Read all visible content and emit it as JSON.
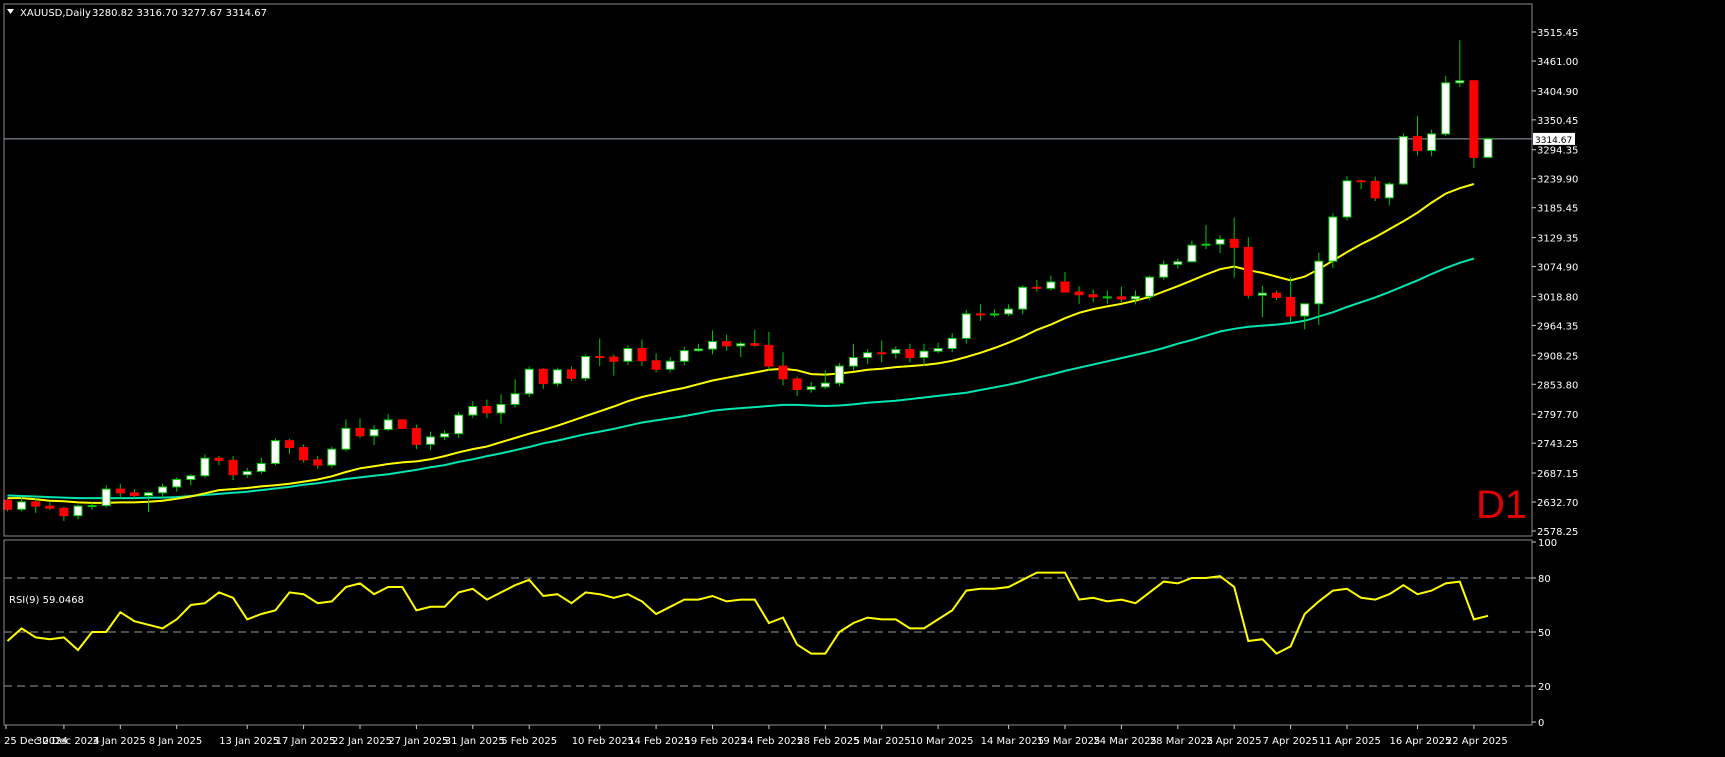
{
  "header": {
    "symbol_line": "XAUUSD,Daily",
    "ohlc": "3280.82 3316.70 3277.67 3314.67"
  },
  "timeframe_badge": "D1",
  "rsi_header": "RSI(9) 59.0468",
  "current_price_label": "3314.67",
  "colors": {
    "background": "#000000",
    "bull_candle": "#ffffff",
    "bear_candle": "#ff0000",
    "wick": "#00c800",
    "ma_fast": "#ffff00",
    "ma_slow": "#00e5b0",
    "rsi_line": "#ffff00",
    "timeframe": "#e00000"
  },
  "chart_data": [
    {
      "type": "candlestick",
      "title": "XAUUSD,Daily",
      "ylim": [
        2578.25,
        3538.0
      ],
      "y_ticks": [
        "3515.45",
        "3461.00",
        "3404.90",
        "3350.45",
        "3294.35",
        "3239.90",
        "3185.45",
        "3129.35",
        "3074.90",
        "3018.80",
        "2964.35",
        "2908.25",
        "2853.80",
        "2797.70",
        "2743.25",
        "2687.15",
        "2632.70",
        "2578.25"
      ],
      "x_ticks": [
        "25 Dec 2024",
        "30 Dec 2024",
        "3 Jan 2025",
        "8 Jan 2025",
        "13 Jan 2025",
        "17 Jan 2025",
        "22 Jan 2025",
        "27 Jan 2025",
        "31 Jan 2025",
        "5 Feb 2025",
        "10 Feb 2025",
        "14 Feb 2025",
        "19 Feb 2025",
        "24 Feb 2025",
        "28 Feb 2025",
        "5 Mar 2025",
        "10 Mar 2025",
        "14 Mar 2025",
        "19 Mar 2025",
        "24 Mar 2025",
        "28 Mar 2025",
        "2 Apr 2025",
        "7 Apr 2025",
        "11 Apr 2025",
        "16 Apr 2025",
        "22 Apr 2025"
      ],
      "last_price": 3314.67,
      "candles": [
        [
          2636,
          2638,
          2615,
          2619
        ],
        [
          2619,
          2642,
          2615,
          2633
        ],
        [
          2633,
          2640,
          2612,
          2625
        ],
        [
          2625,
          2632,
          2618,
          2621
        ],
        [
          2621,
          2624,
          2597,
          2607
        ],
        [
          2607,
          2628,
          2600,
          2625
        ],
        [
          2625,
          2631,
          2618,
          2626
        ],
        [
          2626,
          2664,
          2622,
          2657
        ],
        [
          2657,
          2667,
          2640,
          2650
        ],
        [
          2650,
          2657,
          2638,
          2645
        ],
        [
          2645,
          2652,
          2614,
          2650
        ],
        [
          2650,
          2667,
          2640,
          2661
        ],
        [
          2661,
          2679,
          2652,
          2675
        ],
        [
          2675,
          2685,
          2664,
          2682
        ],
        [
          2682,
          2722,
          2678,
          2715
        ],
        [
          2715,
          2719,
          2702,
          2711
        ],
        [
          2711,
          2719,
          2674,
          2684
        ],
        [
          2684,
          2697,
          2678,
          2690
        ],
        [
          2690,
          2716,
          2685,
          2705
        ],
        [
          2705,
          2752,
          2702,
          2748
        ],
        [
          2748,
          2751,
          2723,
          2735
        ],
        [
          2735,
          2741,
          2707,
          2712
        ],
        [
          2712,
          2719,
          2696,
          2702
        ],
        [
          2702,
          2737,
          2697,
          2732
        ],
        [
          2732,
          2788,
          2728,
          2771
        ],
        [
          2771,
          2790,
          2753,
          2757
        ],
        [
          2757,
          2777,
          2740,
          2769
        ],
        [
          2769,
          2798,
          2766,
          2787
        ],
        [
          2787,
          2788,
          2770,
          2771
        ],
        [
          2771,
          2778,
          2732,
          2741
        ],
        [
          2741,
          2765,
          2730,
          2755
        ],
        [
          2755,
          2767,
          2749,
          2761
        ],
        [
          2761,
          2802,
          2753,
          2796
        ],
        [
          2796,
          2822,
          2791,
          2812
        ],
        [
          2812,
          2825,
          2790,
          2800
        ],
        [
          2800,
          2835,
          2780,
          2816
        ],
        [
          2816,
          2863,
          2810,
          2836
        ],
        [
          2836,
          2887,
          2830,
          2882
        ],
        [
          2882,
          2884,
          2845,
          2855
        ],
        [
          2855,
          2885,
          2850,
          2881
        ],
        [
          2881,
          2887,
          2860,
          2865
        ],
        [
          2865,
          2910,
          2860,
          2906
        ],
        [
          2906,
          2940,
          2888,
          2905
        ],
        [
          2905,
          2910,
          2870,
          2897
        ],
        [
          2897,
          2927,
          2890,
          2921
        ],
        [
          2921,
          2938,
          2888,
          2898
        ],
        [
          2898,
          2912,
          2876,
          2882
        ],
        [
          2882,
          2905,
          2877,
          2897
        ],
        [
          2897,
          2924,
          2890,
          2917
        ],
        [
          2917,
          2930,
          2915,
          2920
        ],
        [
          2920,
          2955,
          2910,
          2934
        ],
        [
          2934,
          2947,
          2917,
          2926
        ],
        [
          2926,
          2934,
          2905,
          2930
        ],
        [
          2930,
          2956,
          2924,
          2927
        ],
        [
          2927,
          2952,
          2880,
          2888
        ],
        [
          2888,
          2914,
          2852,
          2864
        ],
        [
          2864,
          2868,
          2832,
          2844
        ],
        [
          2844,
          2858,
          2838,
          2849
        ],
        [
          2849,
          2880,
          2845,
          2856
        ],
        [
          2856,
          2894,
          2850,
          2888
        ],
        [
          2888,
          2930,
          2880,
          2904
        ],
        [
          2904,
          2920,
          2892,
          2913
        ],
        [
          2913,
          2936,
          2895,
          2912
        ],
        [
          2912,
          2925,
          2902,
          2919
        ],
        [
          2919,
          2930,
          2895,
          2904
        ],
        [
          2904,
          2930,
          2888,
          2916
        ],
        [
          2916,
          2932,
          2912,
          2921
        ],
        [
          2921,
          2950,
          2914,
          2940
        ],
        [
          2940,
          2994,
          2930,
          2986
        ],
        [
          2986,
          3004,
          2973,
          2984
        ],
        [
          2984,
          2995,
          2980,
          2986
        ],
        [
          2986,
          3004,
          2982,
          2995
        ],
        [
          2995,
          3040,
          2985,
          3036
        ],
        [
          3036,
          3050,
          3028,
          3034
        ],
        [
          3034,
          3058,
          3030,
          3046
        ],
        [
          3046,
          3065,
          3028,
          3027
        ],
        [
          3027,
          3038,
          3005,
          3022
        ],
        [
          3022,
          3032,
          3008,
          3018
        ],
        [
          3018,
          3030,
          3005,
          3018
        ],
        [
          3018,
          3037,
          3008,
          3014
        ],
        [
          3014,
          3030,
          3004,
          3019
        ],
        [
          3019,
          3058,
          3012,
          3055
        ],
        [
          3055,
          3086,
          3050,
          3079
        ],
        [
          3079,
          3090,
          3071,
          3084
        ],
        [
          3084,
          3124,
          3083,
          3115
        ],
        [
          3115,
          3153,
          3108,
          3117
        ],
        [
          3117,
          3134,
          3100,
          3126
        ],
        [
          3126,
          3167,
          3054,
          3111
        ],
        [
          3111,
          3130,
          3015,
          3021
        ],
        [
          3021,
          3039,
          2980,
          3025
        ],
        [
          3025,
          3030,
          3012,
          3017
        ],
        [
          3017,
          3055,
          2970,
          2982
        ],
        [
          2982,
          3005,
          2957,
          3005
        ],
        [
          3005,
          3101,
          2965,
          3085
        ],
        [
          3085,
          3175,
          3072,
          3168
        ],
        [
          3168,
          3245,
          3162,
          3236
        ],
        [
          3236,
          3238,
          3220,
          3235
        ],
        [
          3235,
          3244,
          3198,
          3204
        ],
        [
          3204,
          3234,
          3190,
          3230
        ],
        [
          3230,
          3325,
          3228,
          3319
        ],
        [
          3319,
          3358,
          3284,
          3293
        ],
        [
          3293,
          3332,
          3282,
          3324
        ],
        [
          3324,
          3433,
          3320,
          3420
        ],
        [
          3420,
          3500,
          3412,
          3424
        ],
        [
          3424,
          3424,
          3260,
          3280
        ],
        [
          3280,
          3317,
          3278,
          3315
        ]
      ],
      "ma_fast": [
        2640,
        2640,
        2638,
        2635,
        2634,
        2632,
        2631,
        2631,
        2632,
        2632,
        2633,
        2635,
        2639,
        2643,
        2649,
        2655,
        2657,
        2659,
        2662,
        2664,
        2667,
        2671,
        2675,
        2681,
        2689,
        2696,
        2700,
        2704,
        2707,
        2709,
        2713,
        2719,
        2726,
        2732,
        2737,
        2745,
        2753,
        2761,
        2768,
        2776,
        2785,
        2794,
        2803,
        2812,
        2822,
        2830,
        2836,
        2842,
        2847,
        2854,
        2861,
        2866,
        2871,
        2876,
        2881,
        2883,
        2880,
        2873,
        2872,
        2874,
        2877,
        2881,
        2883,
        2886,
        2888,
        2890,
        2893,
        2898,
        2905,
        2913,
        2922,
        2932,
        2943,
        2956,
        2966,
        2978,
        2988,
        2995,
        3000,
        3005,
        3011,
        3018,
        3028,
        3038,
        3049,
        3060,
        3070,
        3075,
        3068,
        3063,
        3056,
        3049,
        3056,
        3070,
        3086,
        3102,
        3117,
        3130,
        3145,
        3160,
        3176,
        3195,
        3212,
        3222,
        3230
      ],
      "ma_slow": [
        2645,
        2644,
        2643,
        2642,
        2641,
        2640,
        2640,
        2640,
        2640,
        2640,
        2641,
        2641,
        2642,
        2644,
        2646,
        2648,
        2650,
        2652,
        2655,
        2658,
        2661,
        2665,
        2668,
        2672,
        2676,
        2679,
        2682,
        2685,
        2689,
        2693,
        2698,
        2702,
        2708,
        2713,
        2719,
        2724,
        2730,
        2736,
        2743,
        2748,
        2754,
        2760,
        2765,
        2770,
        2776,
        2782,
        2786,
        2790,
        2794,
        2799,
        2804,
        2807,
        2809,
        2811,
        2813,
        2815,
        2815,
        2814,
        2813,
        2814,
        2816,
        2819,
        2821,
        2823,
        2826,
        2829,
        2832,
        2835,
        2838,
        2843,
        2848,
        2853,
        2859,
        2866,
        2872,
        2879,
        2885,
        2891,
        2897,
        2903,
        2909,
        2915,
        2922,
        2930,
        2937,
        2945,
        2953,
        2958,
        2962,
        2964,
        2966,
        2969,
        2973,
        2981,
        2989,
        2999,
        3008,
        3017,
        3027,
        3038,
        3049,
        3061,
        3072,
        3082,
        3090
      ],
      "rsi": [
        45,
        52,
        47,
        46,
        47,
        40,
        50,
        50,
        61,
        56,
        54,
        52,
        57,
        65,
        66,
        72,
        69,
        57,
        60,
        62,
        72,
        71,
        66,
        67,
        75,
        77,
        71,
        75,
        75,
        62,
        64,
        64,
        72,
        74,
        68,
        72,
        76,
        79,
        70,
        71,
        66,
        72,
        71,
        69,
        71,
        67,
        60,
        64,
        68,
        68,
        70,
        67,
        68,
        68,
        55,
        58,
        43,
        38,
        38,
        50,
        55,
        58,
        57,
        57,
        52,
        52,
        57,
        62,
        73,
        74,
        74,
        75,
        79,
        83,
        83,
        83,
        68,
        69,
        67,
        68,
        66,
        72,
        78,
        77,
        80,
        80,
        81,
        75,
        45,
        46,
        38,
        42,
        60,
        67,
        73,
        74,
        69,
        68,
        71,
        76,
        71,
        73,
        77,
        78,
        57,
        59
      ],
      "rsi_levels": [
        80,
        50,
        20
      ],
      "rsi_ticks": [
        "100",
        "80",
        "50",
        "20",
        "0"
      ]
    }
  ]
}
